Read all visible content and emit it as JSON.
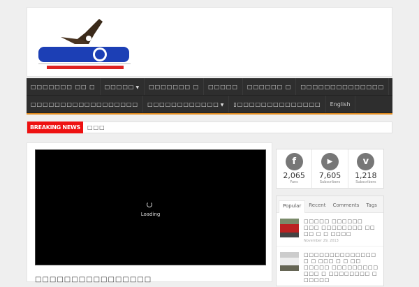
{
  "header": {
    "logo_alt": "logo"
  },
  "nav": {
    "row1": [
      {
        "label": "□□□□□□□ □□ □"
      },
      {
        "label": "□□□□□",
        "dropdown": true
      },
      {
        "label": "□□□□□□□ □"
      },
      {
        "label": "□□□□□"
      },
      {
        "label": "□□□□□□ □"
      },
      {
        "label": "□□□□□□□□□□□□□□"
      }
    ],
    "row2": [
      {
        "label": "□□□□□□□□□□□□□□□□□□"
      },
      {
        "label": "□□□□□□□□□□□□",
        "dropdown": true
      },
      {
        "label": "▯□□□□□□□□□□□□□□"
      },
      {
        "label": "English"
      }
    ]
  },
  "breaking": {
    "label": "BREAKING NEWS",
    "text": "□□□"
  },
  "video": {
    "loading": "Loading"
  },
  "main": {
    "post_title": "□□□□□□□□□□□□□□□□"
  },
  "social": [
    {
      "icon": "facebook-icon",
      "glyph": "f",
      "count": "2,065",
      "unit": "Fans"
    },
    {
      "icon": "youtube-icon",
      "glyph": "▶",
      "count": "7,605",
      "unit": "Subscribers"
    },
    {
      "icon": "vimeo-icon",
      "glyph": "v",
      "count": "1,218",
      "unit": "Subscribers"
    }
  ],
  "tabs": {
    "items": [
      "Popular",
      "Recent",
      "Comments",
      "Tags"
    ],
    "posts": [
      {
        "title": "□□□□□ □□□□□□ □□□ □□□□□□□□ □□ □□ □ □ □□□□",
        "date": "November 29, 2013"
      },
      {
        "title": "□□□□□□□□□□□□□□ □ □ □□□ □ □ □□ □□□□□ □□□□□□□□□ □□□ □ □□□□□□□□ □ □□□□□"
      }
    ]
  },
  "colors": {
    "accent": "#e08a1e",
    "breaking": "#ee1111",
    "nav": "#2e2e2e"
  }
}
